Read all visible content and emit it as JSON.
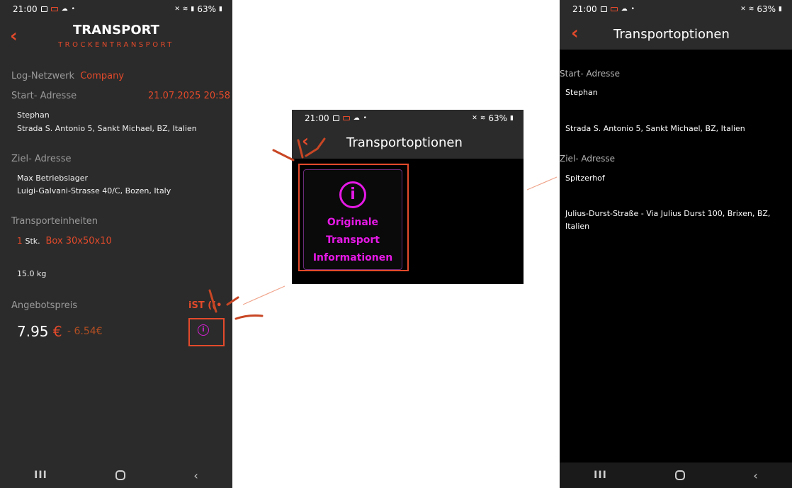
{
  "status_bar": {
    "time": "21:00",
    "battery": "63%"
  },
  "left_screen": {
    "title": "TRANSPORT",
    "subtitle": "TROCKENTRANSPORT",
    "network_label": "Log-Netzwerk",
    "network_value": "Company",
    "start_label": "Start- Adresse",
    "start_datetime": "21.07.2025 20:58",
    "start_name": "Stephan",
    "start_address": "Strada S. Antonio 5, Sankt Michael, BZ, Italien",
    "target_label": "Ziel- Adresse",
    "target_name": "Max Betriebslager",
    "target_address": "Luigi-Galvani-Strasse 40/C, Bozen, Italy",
    "units_label": "Transporteinheiten",
    "unit_count": "1",
    "unit_suffix": "Stk.",
    "unit_name": "Box 30x50x10",
    "weight": "15.0 kg",
    "price_label": "Angebotspreis",
    "price_value": "7.95",
    "price_currency": "€",
    "discount": "- 6.54€",
    "ist_label": "iST",
    "info_symbol": "i"
  },
  "middle_screen": {
    "title": "Transportoptionen",
    "info_symbol": "i",
    "info_line1": "Originale",
    "info_line2": "Transport",
    "info_line3": "Informationen"
  },
  "right_screen": {
    "title": "Transportoptionen",
    "start_label": "Start- Adresse",
    "start_name": "Stephan",
    "start_address": "Strada S. Antonio 5, Sankt Michael, BZ, Italien",
    "target_label": "Ziel- Adresse",
    "target_name": "Spitzerhof",
    "target_address": "Julius-Durst-Straße - Via Julius Durst 100, Brixen, BZ, Italien"
  },
  "colors": {
    "accent": "#e34a2b",
    "info_magenta": "#e619e6",
    "panel_dark": "#2b2b2b",
    "background_black": "#000000"
  }
}
